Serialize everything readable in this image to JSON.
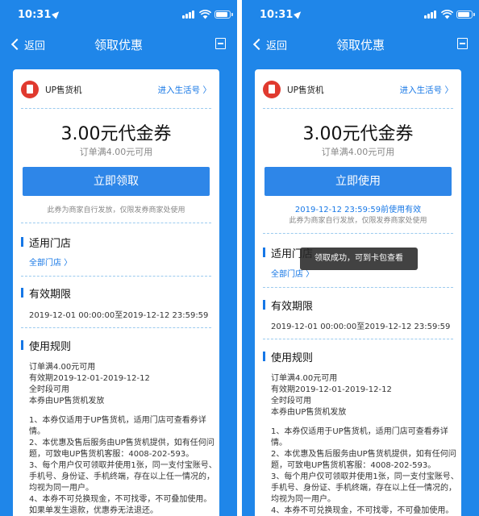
{
  "status": {
    "time": "10:31"
  },
  "nav": {
    "back_label": "返回",
    "title": "领取优惠"
  },
  "merchant": {
    "name": "UP售货机",
    "link": "进入生活号 〉"
  },
  "coupon": {
    "amount": "3.00元代金券",
    "condition": "订单满4.00元可用"
  },
  "left": {
    "button": "立即领取",
    "issuer_note": "此券为商家自行发放，仅限发券商家处使用"
  },
  "right": {
    "button": "立即使用",
    "valid_until": "2019-12-12 23:59:59前使用有效",
    "issuer_note": "此券为商家自行发放，仅限发券商家处使用",
    "toast": "领取成功，可到卡包查看"
  },
  "stores": {
    "title": "适用门店",
    "all": "全部门店 〉"
  },
  "validity": {
    "title": "有效期限",
    "period": "2019-12-01 00:00:00至2019-12-12 23:59:59"
  },
  "rules": {
    "title": "使用规则",
    "summary": [
      "订单满4.00元可用",
      "有效期2019-12-01-2019-12-12",
      "全时段可用",
      "本券由UP售货机发放"
    ],
    "details": [
      "1、本券仅适用于UP售货机，适用门店可查看券详",
      "情。",
      "2、本优惠及售后服务由UP售货机提供，如有任何问",
      "题，可致电UP售货机客服：4008-202-593。",
      "3、每个用户仅可领取并使用1张，同一支付宝账号、",
      "手机号、身份证、手机终端，存在以上任一情况的，",
      "均视为同一用户。",
      "4、本券不可兑换现金，不可找零，不可叠加使用。",
      "如果单发生退款，优惠券无法退还。"
    ]
  },
  "colors": {
    "header_blue": "#1f86e9",
    "button_blue": "#2e86e8",
    "link_blue": "#1677e6",
    "merchant_red": "#e03a2f"
  }
}
